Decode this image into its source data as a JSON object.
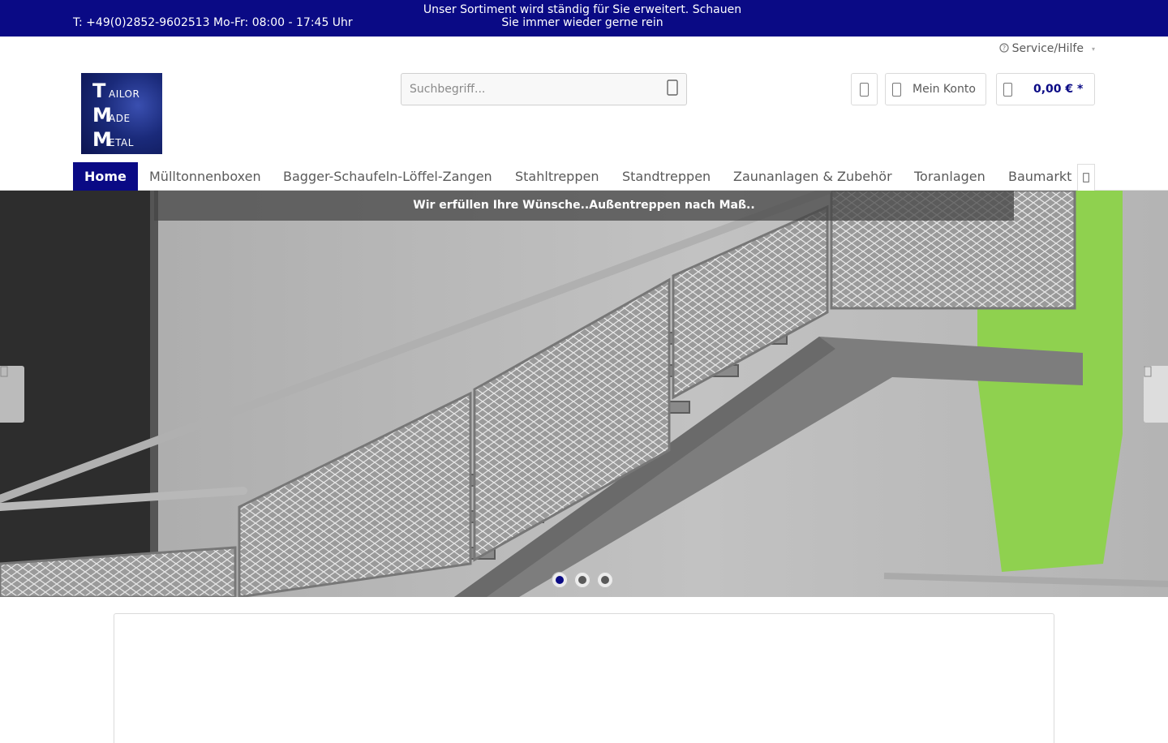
{
  "topbar": {
    "phone": "T: +49(0)2852-9602513 Mo-Fr: 08:00 - 17:45 Uhr",
    "promo_line1": "Unser Sortiment wird ständig für Sie erweitert. Schauen",
    "promo_line2": "Sie immer wieder gerne rein"
  },
  "service": {
    "label": "Service/Hilfe",
    "icon": "question-icon"
  },
  "logo": {
    "rows": [
      {
        "big": "T",
        "small": "AILOR"
      },
      {
        "big": "M",
        "small": "ADE"
      },
      {
        "big": "M",
        "small": "ETAL"
      }
    ]
  },
  "search": {
    "placeholder": "Suchbegriff...",
    "icon": "search-icon"
  },
  "header_actions": {
    "wishlist_icon": "heart-icon",
    "account_label": "Mein Konto",
    "account_icon": "user-icon",
    "cart_amount": "0,00 € *",
    "cart_icon": "bag-icon"
  },
  "nav": {
    "items": [
      "Home",
      "Mülltonnenboxen",
      "Bagger-Schaufeln-Löffel-Zangen",
      "Stahltreppen",
      "Standtreppen",
      "Zaunanlagen & Zubehör",
      "Toranlagen",
      "Baumarkt"
    ],
    "active_index": 0,
    "more_icon": "chevron-right-icon"
  },
  "slider": {
    "caption": "Wir erfüllen Ihre Wünsche..Außentreppen nach Maß..",
    "slide_count": 3,
    "active_slide": 1,
    "prev_icon": "chevron-left-icon",
    "next_icon": "chevron-right-icon"
  },
  "colors": {
    "brand": "#0a0a85",
    "accent_green": "#8fd14f"
  }
}
